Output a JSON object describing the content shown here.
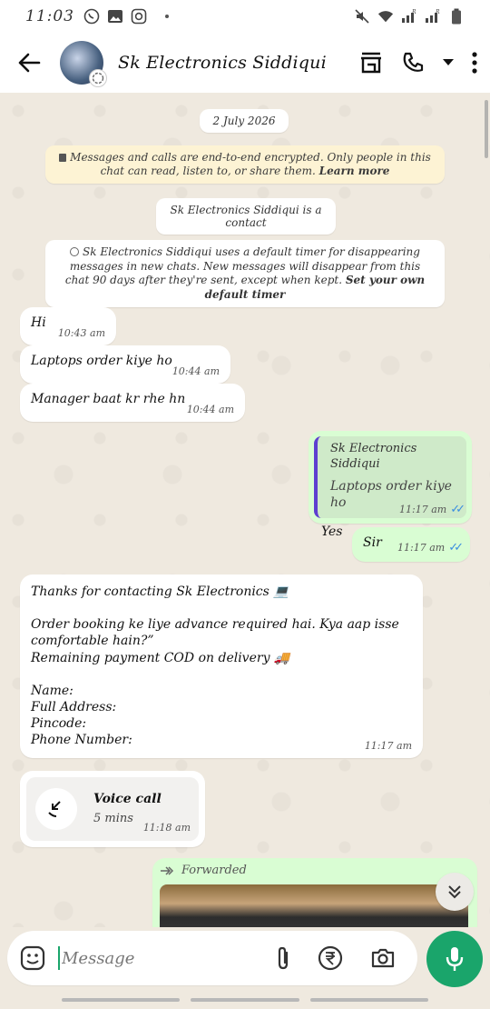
{
  "status_bar": {
    "time": "11:03",
    "left_icons": [
      "whatsapp-icon",
      "gallery-icon",
      "instagram-icon"
    ],
    "right_icons": [
      "mute-icon",
      "wifi-icon",
      "signal-icon",
      "signal-icon",
      "battery-icon"
    ],
    "signal_label_1": "R",
    "signal_label_2": "R"
  },
  "header": {
    "title": "Sk Electronics Siddiqui"
  },
  "system": {
    "date": "2 July 2026",
    "encryption_text": "Messages and calls are end-to-end encrypted. Only people in this chat can read, listen to, or share them.",
    "encryption_link": "Learn more",
    "contact_notice": "Sk Electronics Siddiqui is a contact",
    "timer_text": "Sk Electronics Siddiqui uses a default timer for disappearing messages in new chats. New messages will disappear from this chat 90 days after they're sent, except when kept.",
    "timer_link": "Set your own default timer"
  },
  "messages": [
    {
      "text": "Hi",
      "time": "10:43 am"
    },
    {
      "text": "Laptops order kiye ho",
      "time": "10:44 am"
    },
    {
      "text": "Manager baat kr rhe hn",
      "time": "10:44 am"
    }
  ],
  "outgoing": {
    "quoted_name": "Sk Electronics Siddiqui",
    "quoted_text": "Laptops order kiye ho",
    "reply_text": "Yes",
    "reply_time": "11:17 am",
    "sir_text": "Sir",
    "sir_time": "11:17 am",
    "ticks": "✓✓"
  },
  "long_message": {
    "line1": "Thanks for contacting Sk Electronics 💻",
    "line2": "Order booking ke liye advance required hai. Kya aap isse comfortable hain?”",
    "line3": "Remaining payment COD on delivery 🚚",
    "field1": "Name:",
    "field2": "Full Address:",
    "field3": "Pincode:",
    "field4": "Phone Number:",
    "time": "11:17 am"
  },
  "voice_call": {
    "title": "Voice call",
    "duration": "5 mins",
    "time": "11:18 am"
  },
  "forwarded": {
    "label": "Forwarded"
  },
  "composer": {
    "placeholder": "Message"
  },
  "colors": {
    "accent": "#1aa56b",
    "outgoing_bubble": "#d9fdd3",
    "chat_bg": "#efe9df",
    "encryption_bg": "#fdf3d4",
    "tick_blue": "#3b8ee0"
  }
}
